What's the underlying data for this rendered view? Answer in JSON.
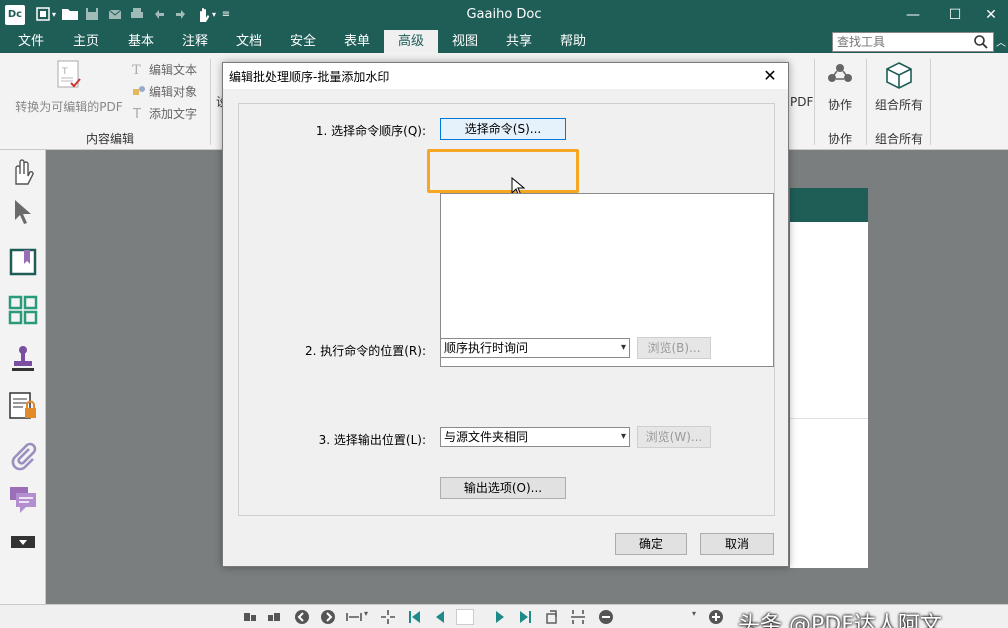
{
  "app": {
    "title": "Gaaiho Doc",
    "logo": "Dc",
    "accent_color": "#1f5d57"
  },
  "window_controls": {
    "minimize": "—",
    "maximize": "☐",
    "close": "✕"
  },
  "menu": {
    "items": [
      "文件",
      "主页",
      "基本",
      "注释",
      "文档",
      "安全",
      "表单",
      "高级",
      "视图",
      "共享",
      "帮助"
    ],
    "active": "高级",
    "search_placeholder": "查找工具"
  },
  "ribbon": {
    "convert_label": "转换为可编辑的PDF",
    "edit_text": "编辑文本",
    "edit_object": "编辑对象",
    "add_text": "添加文字",
    "group_content_edit": "内容编辑",
    "partial_label_1": "设",
    "pdf_label": "PDF",
    "collab_label": "协作",
    "collab_group": "协作",
    "combine_label": "组合所有",
    "combine_group": "组合所有"
  },
  "dialog": {
    "title": "编辑批处理顺序-批量添加水印",
    "close": "✕",
    "step1_label": "1. 选择命令顺序(Q):",
    "select_command_button": "选择命令(S)...",
    "step2_label": "2. 执行命令的位置(R):",
    "execute_location_value": "顺序执行时询问",
    "browse_b": "浏览(B)...",
    "step3_label": "3. 选择输出位置(L):",
    "output_location_value": "与源文件夹相同",
    "browse_w": "浏览(W)...",
    "output_options_button": "输出选项(O)...",
    "ok_button": "确定",
    "cancel_button": "取消",
    "highlight_color": "#f5a623"
  },
  "watermark": {
    "text": "头条 @PDF达人阿文"
  }
}
